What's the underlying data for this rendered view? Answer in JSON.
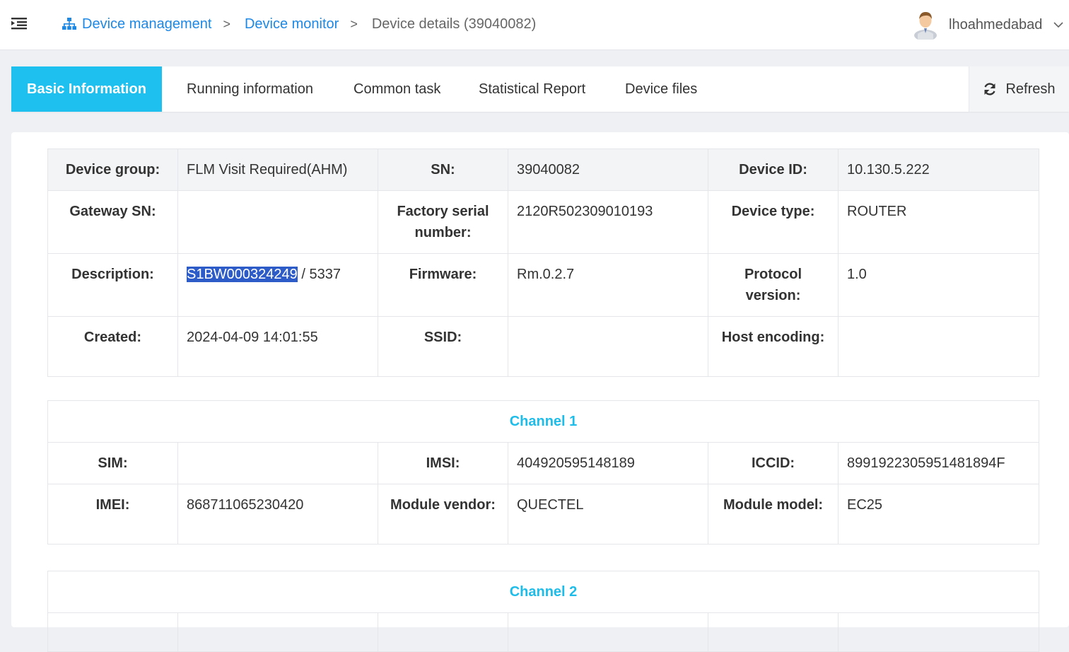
{
  "breadcrumb": {
    "items": [
      "Device management",
      "Device monitor"
    ],
    "separator": ">",
    "current": "Device details (39040082)"
  },
  "user": {
    "name": "lhoahmedabad"
  },
  "tabs": {
    "basic": "Basic Information",
    "running": "Running information",
    "common": "Common task",
    "statistical": "Statistical Report",
    "files": "Device files",
    "refresh": "Refresh"
  },
  "basic": {
    "device_group_label": "Device group:",
    "device_group": "FLM Visit Required(AHM)",
    "sn_label": "SN:",
    "sn": "39040082",
    "device_id_label": "Device ID:",
    "device_id": "10.130.5.222",
    "gateway_sn_label": "Gateway SN:",
    "gateway_sn": "",
    "factory_serial_label": "Factory serial number:",
    "factory_serial": "2120R502309010193",
    "device_type_label": "Device type:",
    "device_type": "ROUTER",
    "description_label": "Description:",
    "description_selected": "S1BW000324249",
    "description_rest": " / 5337",
    "firmware_label": "Firmware:",
    "firmware": "Rm.0.2.7",
    "protocol_label": "Protocol version:",
    "protocol": "1.0",
    "created_label": "Created:",
    "created": "2024-04-09 14:01:55",
    "ssid_label": "SSID:",
    "ssid": "",
    "host_encoding_label": "Host encoding:",
    "host_encoding": ""
  },
  "channel1": {
    "title": "Channel 1",
    "sim_label": "SIM:",
    "sim": "",
    "imsi_label": "IMSI:",
    "imsi": "404920595148189",
    "iccid_label": "ICCID:",
    "iccid": "8991922305951481894F",
    "imei_label": "IMEI:",
    "imei": "868711065230420",
    "module_vendor_label": "Module vendor:",
    "module_vendor": "QUECTEL",
    "module_model_label": "Module model:",
    "module_model": "EC25"
  },
  "channel2": {
    "title": "Channel 2"
  },
  "colors": {
    "accent": "#1ec0ef",
    "link": "#1e88e5",
    "selection": "#2d5cc9"
  }
}
